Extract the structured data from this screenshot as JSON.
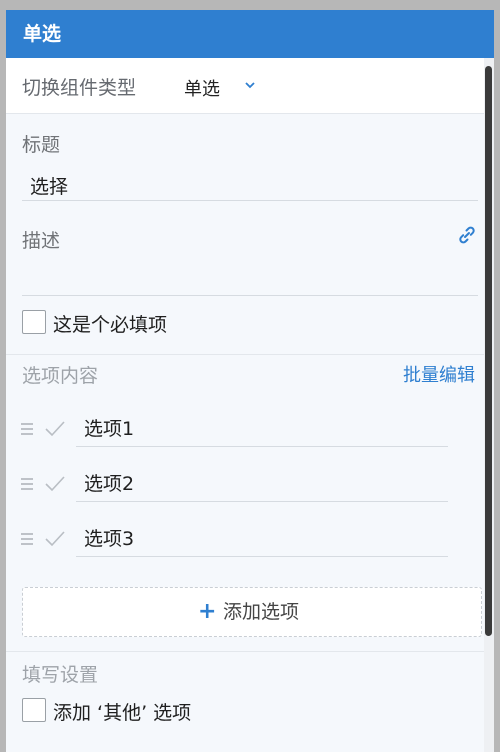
{
  "header": {
    "title": "单选"
  },
  "type_switch": {
    "label": "切换组件类型",
    "value": "单选"
  },
  "title_section": {
    "label": "标题",
    "value": "选择"
  },
  "description_section": {
    "label": "描述",
    "value": ""
  },
  "required": {
    "label": "这是个必填项",
    "checked": false
  },
  "options_section": {
    "label": "选项内容",
    "batch_edit": "批量编辑",
    "items": [
      {
        "label": "选项1"
      },
      {
        "label": "选项2"
      },
      {
        "label": "选项3"
      }
    ],
    "add_label": "添加选项",
    "add_icon": "+"
  },
  "fill_settings": {
    "label": "填写设置",
    "add_other_label": "添加 ‘其他’ 选项",
    "add_other_checked": false
  },
  "colors": {
    "accent": "#2f7fd0",
    "panel_bg": "#f5f8fc",
    "header_text": "#ffffff"
  }
}
